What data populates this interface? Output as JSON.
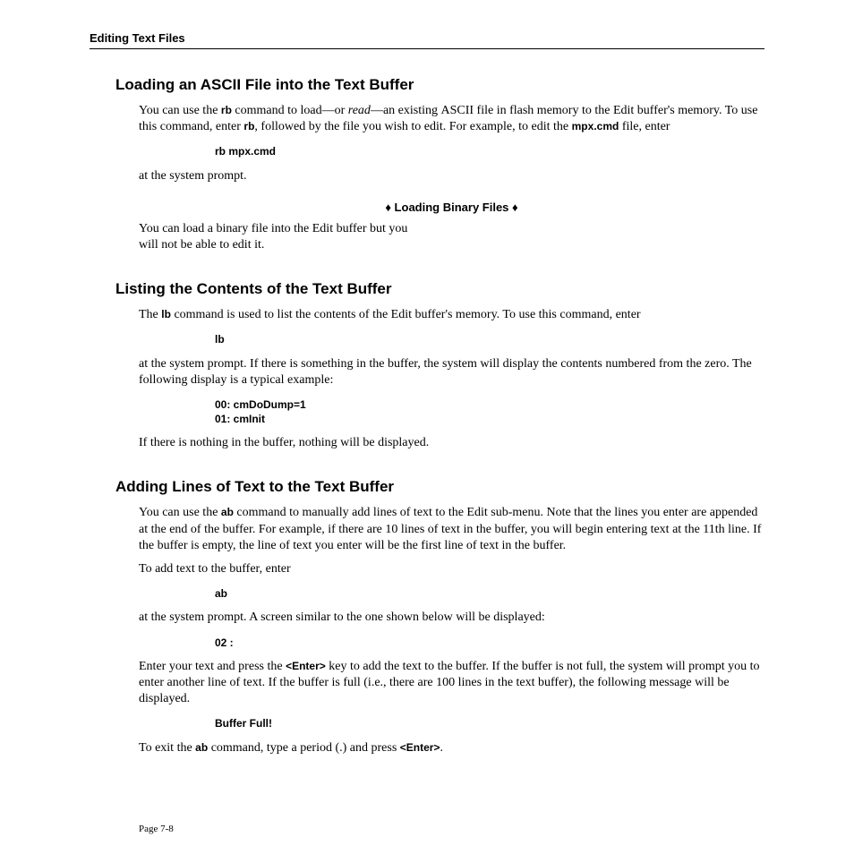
{
  "header": "Editing Text Files",
  "s1": {
    "title": "Loading an ASCII File into the Text Buffer",
    "p1a": "You can use the ",
    "cmd1": "rb",
    "p1b": " command to load—or ",
    "p1c": "read",
    "p1d": "—an existing ",
    "ascii": "ASCII",
    "p1e": " file in flash memory to the Edit buffer's memory. To use this command, enter ",
    "cmd2": "rb",
    "p1f": ", followed by the file you wish to edit. For example, to edit the ",
    "cmd3": "mpx.cmd",
    "p1g": " file, enter",
    "code": "rb mpx.cmd",
    "p2": "at the system prompt.",
    "noteTitle": "♦ Loading Binary Files ♦",
    "noteBody": "You can load a binary file into the Edit buffer but you will not be able to edit it."
  },
  "s2": {
    "title": "Listing the Contents of the Text Buffer",
    "p1a": "The ",
    "cmd1": "lb",
    "p1b": " command is used to list the contents of the Edit buffer's memory. To use this command, enter",
    "code1": "lb",
    "p2": "at the system prompt. If there is something in the buffer, the system will display the contents numbered from the zero. The following display is a typical example:",
    "code2a": "00: cmDoDump=1",
    "code2b": "01: cmInit",
    "p3": "If there is nothing in the buffer, nothing will be displayed."
  },
  "s3": {
    "title": "Adding Lines of Text to the Text Buffer",
    "p1a": "You can use the ",
    "cmd1": "ab",
    "p1b": " command to manually add lines of text to the Edit sub-menu. Note that the lines you enter are appended at the end of the buffer. For example, if there are 10 lines of text in the buffer, you will begin entering text at the 11th line. If the buffer is empty, the line of text you enter will be the first line of text in the buffer.",
    "p2": "To add text to the buffer, enter",
    "code1": "ab",
    "p3": "at the system prompt. A screen similar to the one shown below will be displayed:",
    "code2": "02 :",
    "p4a": "Enter your text and press the ",
    "key1": "<Enter>",
    "p4b": " key to add the text to the buffer. If the buffer is not full, the system will prompt you to enter another line of text. If the buffer is full (i.e., there are 100 lines in the text buffer), the following message will be displayed.",
    "code3": "Buffer Full!",
    "p5a": "To exit the ",
    "cmd2": "ab",
    "p5b": " command, type a period (.) and press ",
    "key2": "<Enter>",
    "p5c": "."
  },
  "pageNumber": "Page 7-8"
}
